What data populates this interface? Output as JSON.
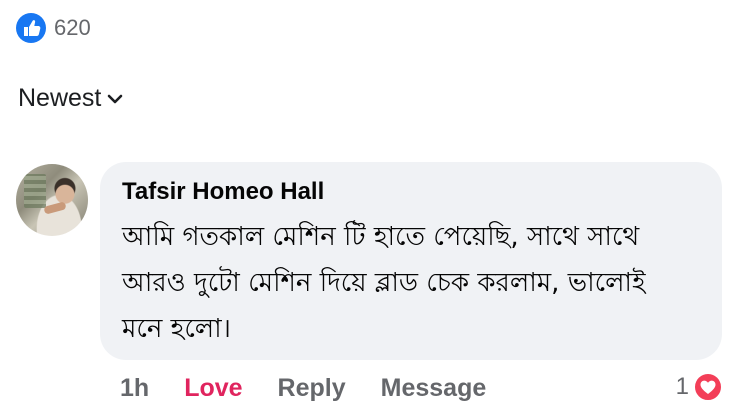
{
  "reactions": {
    "icon": "like-thumb-icon",
    "count": "620",
    "color": "#1877f2"
  },
  "sort": {
    "label": "Newest",
    "icon": "chevron-down-icon"
  },
  "comment": {
    "author": "Tafsir Homeo Hall",
    "text": "আমি গতকাল মেশিন টি হাতে পেয়েছি, সাথে সাথে আরও দুটো মেশিন দিয়ে ব্লাড চেক করলাম, ভালোই মনে হলো।",
    "bubble_color": "#f0f2f5"
  },
  "actions": {
    "time": "1h",
    "love_label": "Love",
    "love_color": "#e0245e",
    "reply_label": "Reply",
    "message_label": "Message",
    "reaction_count": "1",
    "reaction_icon": "heart-icon"
  }
}
